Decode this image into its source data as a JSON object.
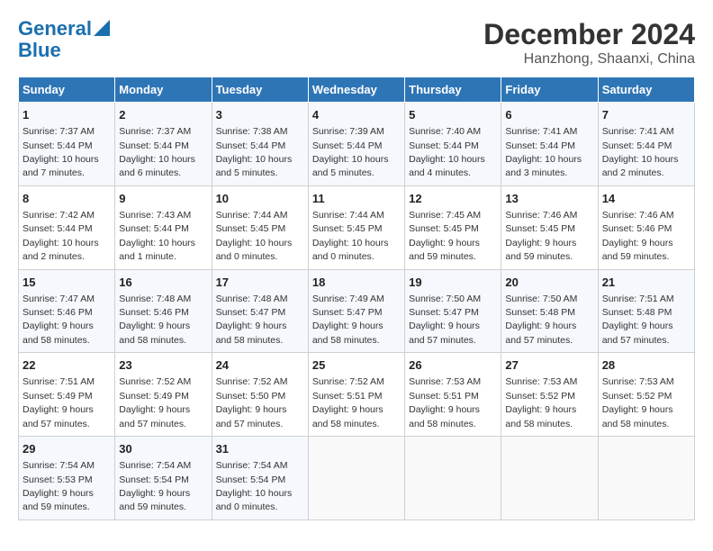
{
  "header": {
    "logo_line1": "General",
    "logo_line2": "Blue",
    "title": "December 2024",
    "subtitle": "Hanzhong, Shaanxi, China"
  },
  "weekdays": [
    "Sunday",
    "Monday",
    "Tuesday",
    "Wednesday",
    "Thursday",
    "Friday",
    "Saturday"
  ],
  "weeks": [
    [
      {
        "day": "1",
        "sunrise": "7:37 AM",
        "sunset": "5:44 PM",
        "daylight": "10 hours and 7 minutes."
      },
      {
        "day": "2",
        "sunrise": "7:37 AM",
        "sunset": "5:44 PM",
        "daylight": "10 hours and 6 minutes."
      },
      {
        "day": "3",
        "sunrise": "7:38 AM",
        "sunset": "5:44 PM",
        "daylight": "10 hours and 5 minutes."
      },
      {
        "day": "4",
        "sunrise": "7:39 AM",
        "sunset": "5:44 PM",
        "daylight": "10 hours and 5 minutes."
      },
      {
        "day": "5",
        "sunrise": "7:40 AM",
        "sunset": "5:44 PM",
        "daylight": "10 hours and 4 minutes."
      },
      {
        "day": "6",
        "sunrise": "7:41 AM",
        "sunset": "5:44 PM",
        "daylight": "10 hours and 3 minutes."
      },
      {
        "day": "7",
        "sunrise": "7:41 AM",
        "sunset": "5:44 PM",
        "daylight": "10 hours and 2 minutes."
      }
    ],
    [
      {
        "day": "8",
        "sunrise": "7:42 AM",
        "sunset": "5:44 PM",
        "daylight": "10 hours and 2 minutes."
      },
      {
        "day": "9",
        "sunrise": "7:43 AM",
        "sunset": "5:44 PM",
        "daylight": "10 hours and 1 minute."
      },
      {
        "day": "10",
        "sunrise": "7:44 AM",
        "sunset": "5:45 PM",
        "daylight": "10 hours and 0 minutes."
      },
      {
        "day": "11",
        "sunrise": "7:44 AM",
        "sunset": "5:45 PM",
        "daylight": "10 hours and 0 minutes."
      },
      {
        "day": "12",
        "sunrise": "7:45 AM",
        "sunset": "5:45 PM",
        "daylight": "9 hours and 59 minutes."
      },
      {
        "day": "13",
        "sunrise": "7:46 AM",
        "sunset": "5:45 PM",
        "daylight": "9 hours and 59 minutes."
      },
      {
        "day": "14",
        "sunrise": "7:46 AM",
        "sunset": "5:46 PM",
        "daylight": "9 hours and 59 minutes."
      }
    ],
    [
      {
        "day": "15",
        "sunrise": "7:47 AM",
        "sunset": "5:46 PM",
        "daylight": "9 hours and 58 minutes."
      },
      {
        "day": "16",
        "sunrise": "7:48 AM",
        "sunset": "5:46 PM",
        "daylight": "9 hours and 58 minutes."
      },
      {
        "day": "17",
        "sunrise": "7:48 AM",
        "sunset": "5:47 PM",
        "daylight": "9 hours and 58 minutes."
      },
      {
        "day": "18",
        "sunrise": "7:49 AM",
        "sunset": "5:47 PM",
        "daylight": "9 hours and 58 minutes."
      },
      {
        "day": "19",
        "sunrise": "7:50 AM",
        "sunset": "5:47 PM",
        "daylight": "9 hours and 57 minutes."
      },
      {
        "day": "20",
        "sunrise": "7:50 AM",
        "sunset": "5:48 PM",
        "daylight": "9 hours and 57 minutes."
      },
      {
        "day": "21",
        "sunrise": "7:51 AM",
        "sunset": "5:48 PM",
        "daylight": "9 hours and 57 minutes."
      }
    ],
    [
      {
        "day": "22",
        "sunrise": "7:51 AM",
        "sunset": "5:49 PM",
        "daylight": "9 hours and 57 minutes."
      },
      {
        "day": "23",
        "sunrise": "7:52 AM",
        "sunset": "5:49 PM",
        "daylight": "9 hours and 57 minutes."
      },
      {
        "day": "24",
        "sunrise": "7:52 AM",
        "sunset": "5:50 PM",
        "daylight": "9 hours and 57 minutes."
      },
      {
        "day": "25",
        "sunrise": "7:52 AM",
        "sunset": "5:51 PM",
        "daylight": "9 hours and 58 minutes."
      },
      {
        "day": "26",
        "sunrise": "7:53 AM",
        "sunset": "5:51 PM",
        "daylight": "9 hours and 58 minutes."
      },
      {
        "day": "27",
        "sunrise": "7:53 AM",
        "sunset": "5:52 PM",
        "daylight": "9 hours and 58 minutes."
      },
      {
        "day": "28",
        "sunrise": "7:53 AM",
        "sunset": "5:52 PM",
        "daylight": "9 hours and 58 minutes."
      }
    ],
    [
      {
        "day": "29",
        "sunrise": "7:54 AM",
        "sunset": "5:53 PM",
        "daylight": "9 hours and 59 minutes."
      },
      {
        "day": "30",
        "sunrise": "7:54 AM",
        "sunset": "5:54 PM",
        "daylight": "9 hours and 59 minutes."
      },
      {
        "day": "31",
        "sunrise": "7:54 AM",
        "sunset": "5:54 PM",
        "daylight": "10 hours and 0 minutes."
      },
      null,
      null,
      null,
      null
    ]
  ]
}
